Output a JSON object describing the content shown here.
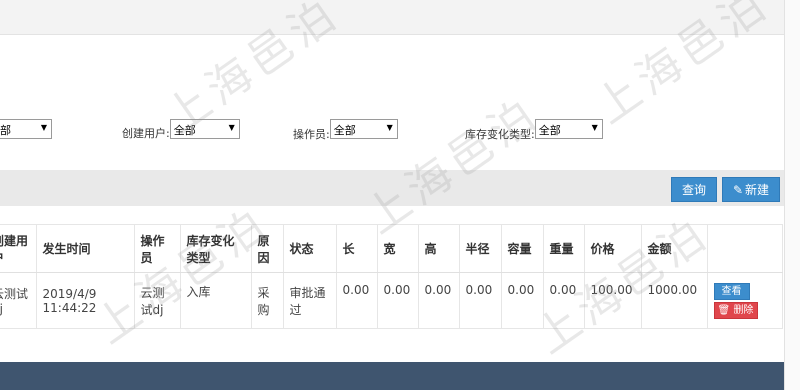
{
  "filters": [
    {
      "label": "",
      "value": "部"
    },
    {
      "label": "创建用户:",
      "value": "全部"
    },
    {
      "label": "操作员:",
      "value": "全部"
    },
    {
      "label": "库存变化类型:",
      "value": "全部"
    }
  ],
  "toolbar": {
    "query_label": "查询",
    "new_label": "新建"
  },
  "table": {
    "headers": [
      "创建用户",
      "发生时间",
      "操作员",
      "库存变化类型",
      "原因",
      "状态",
      "长",
      "宽",
      "高",
      "半径",
      "容量",
      "重量",
      "价格",
      "金额",
      ""
    ],
    "rows": [
      {
        "creator": "云测试dj",
        "time": "2019/4/9 11:44:22",
        "operator": "云测试dj",
        "change_type": "入库",
        "reason": "采购",
        "status": "审批通过",
        "length": "0.00",
        "width": "0.00",
        "height": "0.00",
        "radius": "0.00",
        "capacity": "0.00",
        "weight": "0.00",
        "price": "100.00",
        "amount": "1000.00",
        "view_label": "查看",
        "delete_label": "删除"
      }
    ]
  },
  "watermark": "上海邑泊",
  "colors": {
    "primary": "#3c8dcd",
    "danger": "#e0464c",
    "footer": "#3f556f",
    "toolbar_bg": "#e9e9e9"
  }
}
